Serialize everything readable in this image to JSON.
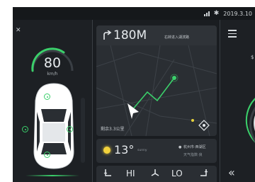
{
  "status_bar": {
    "date": "2019.3.10",
    "icons": [
      "signal-icon",
      "bluetooth-icon"
    ]
  },
  "speed": {
    "value": "80",
    "unit": "km/h"
  },
  "navigation": {
    "distance": "180M",
    "instruction": "右转进入湖滨路",
    "remaining": "剩余3.3公里"
  },
  "weather": {
    "temperature": "13°",
    "condition": "sunny",
    "location": "杭州市·西湖区",
    "air_quality": "天气指数·良"
  },
  "climate": {
    "fan_high": "HI",
    "fan_low": "LO"
  },
  "colors": {
    "accent_green": "#3bd06b",
    "sun_yellow": "#f2d23c",
    "background": "#1a1d21"
  }
}
